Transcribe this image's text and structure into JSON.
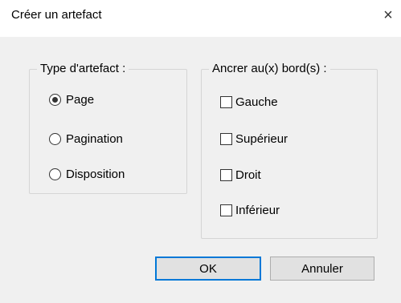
{
  "window": {
    "title": "Créer un artefact",
    "close_glyph": "×"
  },
  "artifact_type": {
    "legend": "Type d'artefact :",
    "options": [
      {
        "label": "Page",
        "checked": true
      },
      {
        "label": "Pagination",
        "checked": false
      },
      {
        "label": "Disposition",
        "checked": false
      }
    ]
  },
  "anchor": {
    "legend": "Ancrer au(x) bord(s) :",
    "options": [
      {
        "label": "Gauche",
        "checked": false
      },
      {
        "label": "Supérieur",
        "checked": false
      },
      {
        "label": "Droit",
        "checked": false
      },
      {
        "label": "Inférieur",
        "checked": false
      }
    ]
  },
  "buttons": {
    "ok_label": "OK",
    "cancel_label": "Annuler"
  },
  "colors": {
    "dialog_bg": "#f0f0f0",
    "button_bg": "#e1e1e1",
    "default_button_border": "#0078d7"
  }
}
